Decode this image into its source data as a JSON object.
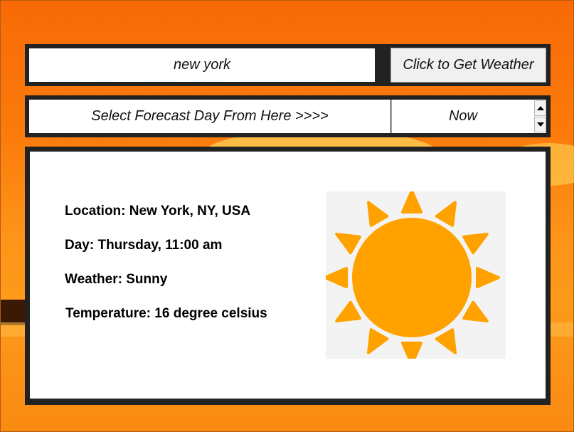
{
  "search": {
    "value": "new york",
    "button_label": "Click to Get Weather"
  },
  "forecast": {
    "label": "Select Forecast Day From Here >>>>",
    "selected": "Now"
  },
  "weather": {
    "location_label": "Location:",
    "location_value": "New York, NY, USA",
    "day_label": "Day:",
    "day_value": "Thursday, 11:00 am",
    "condition_label": "Weather:",
    "condition_value": "Sunny",
    "temperature_label": "Temperature:",
    "temperature_value": "16 degree celsius",
    "icon": "sun-icon",
    "icon_color": "#ffa200",
    "icon_background": "#f3f3f3"
  },
  "colors": {
    "panel_frame": "#222222",
    "background_orange": "#fb7a0b",
    "text": "#000000"
  }
}
